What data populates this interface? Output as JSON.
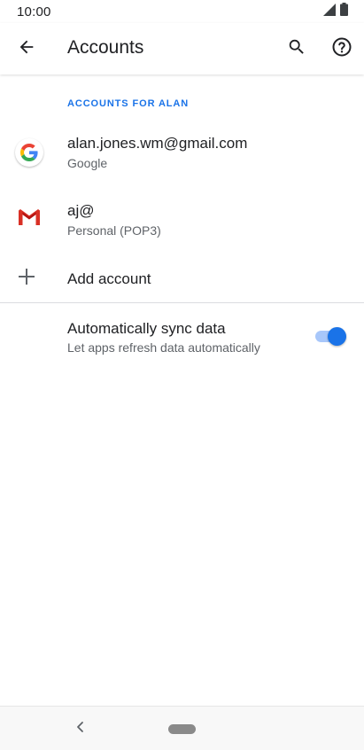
{
  "status_bar": {
    "time": "10:00",
    "icons": [
      "signal-icon",
      "battery-icon"
    ]
  },
  "app_bar": {
    "title": "Accounts",
    "icons": [
      "back-arrow-icon",
      "search-icon",
      "help-icon"
    ]
  },
  "section": {
    "header": "ACCOUNTS FOR ALAN"
  },
  "accounts": [
    {
      "title": "alan.jones.wm@gmail.com",
      "subtitle": "Google",
      "icon": "google-icon"
    },
    {
      "title": "aj@",
      "subtitle": "Personal (POP3)",
      "icon": "gmail-icon"
    }
  ],
  "add_account": {
    "label": "Add account",
    "icon": "plus-icon"
  },
  "sync": {
    "title": "Automatically sync data",
    "subtitle": "Let apps refresh data automatically",
    "enabled": true
  },
  "colors": {
    "accent": "#1a73e8",
    "toggle_track": "#a8c7fa",
    "primary_text": "#202124",
    "secondary_text": "#5f6368"
  },
  "nav_bar": {
    "icons": [
      "nav-back-icon",
      "home-pill-icon"
    ]
  }
}
